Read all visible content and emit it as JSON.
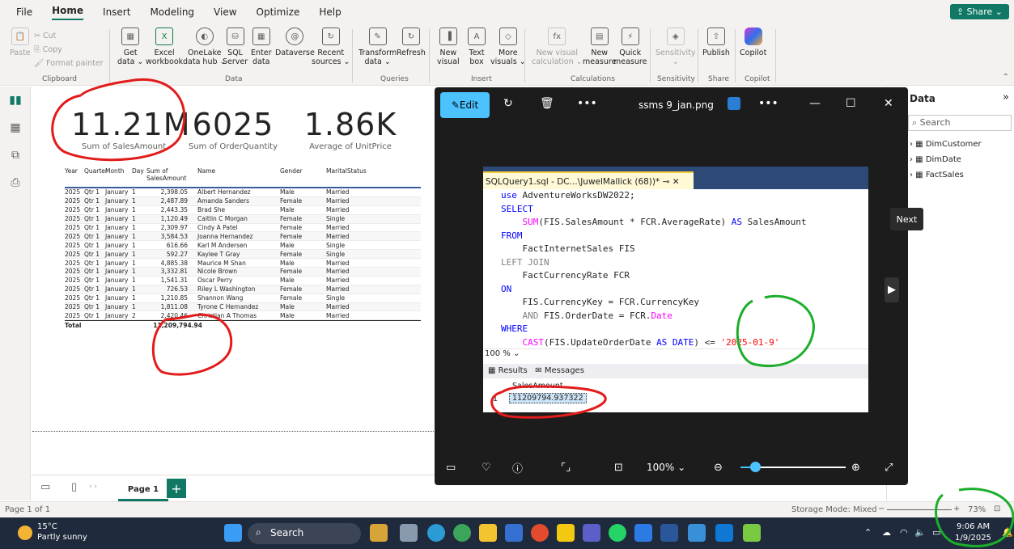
{
  "menu": {
    "items": [
      "File",
      "Home",
      "Insert",
      "Modeling",
      "View",
      "Optimize",
      "Help"
    ],
    "share": "Share"
  },
  "ribbon": {
    "clipboard": {
      "paste": "Paste",
      "cut": "Cut",
      "copy": "Copy",
      "format_painter": "Format painter",
      "group": "Clipboard"
    },
    "data": [
      {
        "l1": "Get",
        "l2": "data ⌄"
      },
      {
        "l1": "Excel",
        "l2": "workbook"
      },
      {
        "l1": "OneLake",
        "l2": "data hub ⌄"
      },
      {
        "l1": "SQL",
        "l2": "Server"
      },
      {
        "l1": "Enter",
        "l2": "data"
      },
      {
        "l1": "Dataverse",
        "l2": ""
      },
      {
        "l1": "Recent",
        "l2": "sources ⌄"
      }
    ],
    "data_group": "Data",
    "queries": [
      {
        "l1": "Transform",
        "l2": "data ⌄"
      },
      {
        "l1": "Refresh",
        "l2": ""
      }
    ],
    "queries_group": "Queries",
    "insert": [
      {
        "l1": "New",
        "l2": "visual"
      },
      {
        "l1": "Text",
        "l2": "box"
      },
      {
        "l1": "More",
        "l2": "visuals ⌄"
      }
    ],
    "insert_group": "Insert",
    "calc": [
      {
        "l1": "New visual",
        "l2": "calculation ⌄"
      },
      {
        "l1": "New",
        "l2": "measure"
      },
      {
        "l1": "Quick",
        "l2": "measure"
      }
    ],
    "calc_group": "Calculations",
    "sensitivity": {
      "label": "Sensitivity",
      "sub": "⌄",
      "group": "Sensitivity"
    },
    "share": {
      "label": "Publish",
      "group": "Share"
    },
    "copilot": {
      "label": "Copilot",
      "group": "Copilot"
    }
  },
  "kpis": [
    {
      "value": "11.21M",
      "label": "Sum of SalesAmount"
    },
    {
      "value": "6025",
      "label": "Sum of OrderQuantity"
    },
    {
      "value": "1.86K",
      "label": "Average of UnitPrice"
    }
  ],
  "table": {
    "headers": [
      "Year",
      "Quarter",
      "Month",
      "Day",
      "Sum of SalesAmount",
      "Name",
      "Gender",
      "MaritalStatus"
    ],
    "rows": [
      [
        "2025",
        "Qtr 1",
        "January",
        "1",
        "2,398.05",
        "Albert Hernandez",
        "Male",
        "Married"
      ],
      [
        "2025",
        "Qtr 1",
        "January",
        "1",
        "2,487.89",
        "Amanda Sanders",
        "Female",
        "Married"
      ],
      [
        "2025",
        "Qtr 1",
        "January",
        "1",
        "2,443.35",
        "Brad She",
        "Male",
        "Married"
      ],
      [
        "2025",
        "Qtr 1",
        "January",
        "1",
        "1,120.49",
        "Caitlin C Morgan",
        "Female",
        "Single"
      ],
      [
        "2025",
        "Qtr 1",
        "January",
        "1",
        "2,309.97",
        "Cindy A Patel",
        "Female",
        "Married"
      ],
      [
        "2025",
        "Qtr 1",
        "January",
        "1",
        "3,584.53",
        "Joanna Hernandez",
        "Female",
        "Married"
      ],
      [
        "2025",
        "Qtr 1",
        "January",
        "1",
        "616.66",
        "Karl M Andersen",
        "Male",
        "Single"
      ],
      [
        "2025",
        "Qtr 1",
        "January",
        "1",
        "592.27",
        "Kaylee T Gray",
        "Female",
        "Single"
      ],
      [
        "2025",
        "Qtr 1",
        "January",
        "1",
        "4,885.38",
        "Maurice M Shan",
        "Male",
        "Married"
      ],
      [
        "2025",
        "Qtr 1",
        "January",
        "1",
        "3,332.81",
        "Nicole Brown",
        "Female",
        "Married"
      ],
      [
        "2025",
        "Qtr 1",
        "January",
        "1",
        "1,541.31",
        "Oscar Perry",
        "Male",
        "Married"
      ],
      [
        "2025",
        "Qtr 1",
        "January",
        "1",
        "726.53",
        "Riley L Washington",
        "Female",
        "Married"
      ],
      [
        "2025",
        "Qtr 1",
        "January",
        "1",
        "1,210.85",
        "Shannon Wang",
        "Female",
        "Single"
      ],
      [
        "2025",
        "Qtr 1",
        "January",
        "1",
        "1,811.08",
        "Tyrone C Hernandez",
        "Male",
        "Married"
      ],
      [
        "2025",
        "Qtr 1",
        "January",
        "2",
        "2,420.46",
        "Christian A Thomas",
        "Male",
        "Married"
      ]
    ],
    "total_label": "Total",
    "total_value": "11,209,794.94"
  },
  "page_tab": "Page 1",
  "status": {
    "page": "Page 1 of 1",
    "storage": "Storage Mode: Mixed",
    "zoom": "73%"
  },
  "data_pane": {
    "title": "Data",
    "search": "Search",
    "tables": [
      "DimCustomer",
      "DimDate",
      "FactSales"
    ]
  },
  "viewer": {
    "edit": "Edit",
    "title": "ssms 9_jan.png",
    "zoom": "100%",
    "next_tip": "Next",
    "ssms_tab": "SQLQuery1.sql - DC...\\JuwelMallick (68))*",
    "code": {
      "l1a": "use",
      "l1b": " AdventureWorksDW2022;",
      "l2": "SELECT",
      "l3a": "    SUM",
      "l3b": "(FIS.SalesAmount * FCR.AverageRate) ",
      "l3c": "AS",
      " l3d": "",
      "l3e": " SalesAmount",
      "l4": "FROM",
      "l5": "    FactInternetSales FIS",
      "l6": "LEFT JOIN",
      "l7": "    FactCurrencyRate FCR",
      "l8": "ON",
      "l9": "    FIS.CurrencyKey = FCR.CurrencyKey",
      "l10a": "    AND",
      "l10b": " FIS.OrderDate = FCR.",
      "l10c": "Date",
      "l11": "WHERE",
      "l12a": "    CAST",
      "l12b": "(FIS.UpdateOrderDate ",
      "l12c": "AS DATE",
      "l12d": ") <= ",
      "l12e": "'2025-01-9'"
    },
    "zoomrow": "100 %",
    "results_tab": "Results",
    "messages_tab": "Messages",
    "col": "SalesAmount",
    "row_num": "1",
    "value": "11209794.937322"
  },
  "taskbar": {
    "temp": "15°C",
    "weather": "Partly sunny",
    "search": "Search",
    "time": "9:06 AM",
    "date": "1/9/2025"
  }
}
